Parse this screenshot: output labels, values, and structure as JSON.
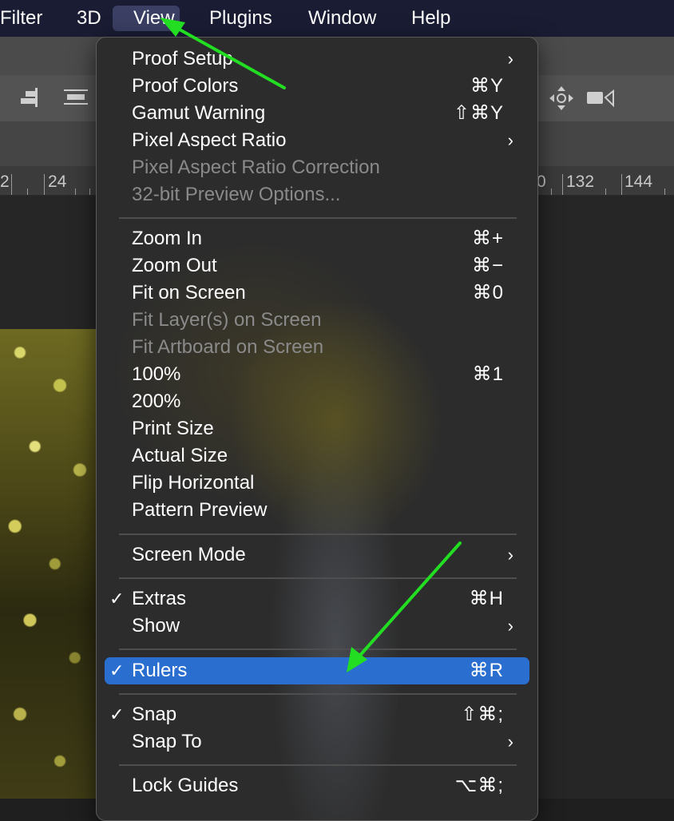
{
  "menubar": {
    "items": [
      {
        "label": "Filter"
      },
      {
        "label": "3D"
      },
      {
        "label": "View"
      },
      {
        "label": "Plugins"
      },
      {
        "label": "Window"
      },
      {
        "label": "Help"
      }
    ]
  },
  "ruler": {
    "labels": [
      "2",
      "24",
      "0",
      "132",
      "144"
    ]
  },
  "view_menu": {
    "items": [
      {
        "label": "Proof Setup",
        "shortcut": "",
        "submenu": true,
        "disabled": false,
        "checked": false
      },
      {
        "label": "Proof Colors",
        "shortcut": "⌘Y"
      },
      {
        "label": "Gamut Warning",
        "shortcut": "⇧⌘Y"
      },
      {
        "label": "Pixel Aspect Ratio",
        "submenu": true
      },
      {
        "label": "Pixel Aspect Ratio Correction",
        "disabled": true
      },
      {
        "label": "32-bit Preview Options...",
        "disabled": true
      },
      {
        "label": "Zoom In",
        "shortcut": "⌘+"
      },
      {
        "label": "Zoom Out",
        "shortcut": "⌘−"
      },
      {
        "label": "Fit on Screen",
        "shortcut": "⌘0"
      },
      {
        "label": "Fit Layer(s) on Screen",
        "disabled": true
      },
      {
        "label": "Fit Artboard on Screen",
        "disabled": true
      },
      {
        "label": "100%",
        "shortcut": "⌘1"
      },
      {
        "label": "200%"
      },
      {
        "label": "Print Size"
      },
      {
        "label": "Actual Size"
      },
      {
        "label": "Flip Horizontal"
      },
      {
        "label": "Pattern Preview"
      },
      {
        "label": "Screen Mode",
        "submenu": true
      },
      {
        "label": "Extras",
        "shortcut": "⌘H",
        "checked": true
      },
      {
        "label": "Show",
        "submenu": true
      },
      {
        "label": "Rulers",
        "shortcut": "⌘R",
        "checked": true,
        "highlighted": true
      },
      {
        "label": "Snap",
        "shortcut": "⇧⌘;",
        "checked": true
      },
      {
        "label": "Snap To",
        "submenu": true
      },
      {
        "label": "Lock Guides",
        "shortcut": "⌥⌘;"
      }
    ],
    "check_glyph": "✓",
    "chevron_glyph": "›"
  },
  "colors": {
    "menubar_bg": "#1a1c34",
    "highlight": "#2a6fd0",
    "arrow": "#22dd22"
  }
}
